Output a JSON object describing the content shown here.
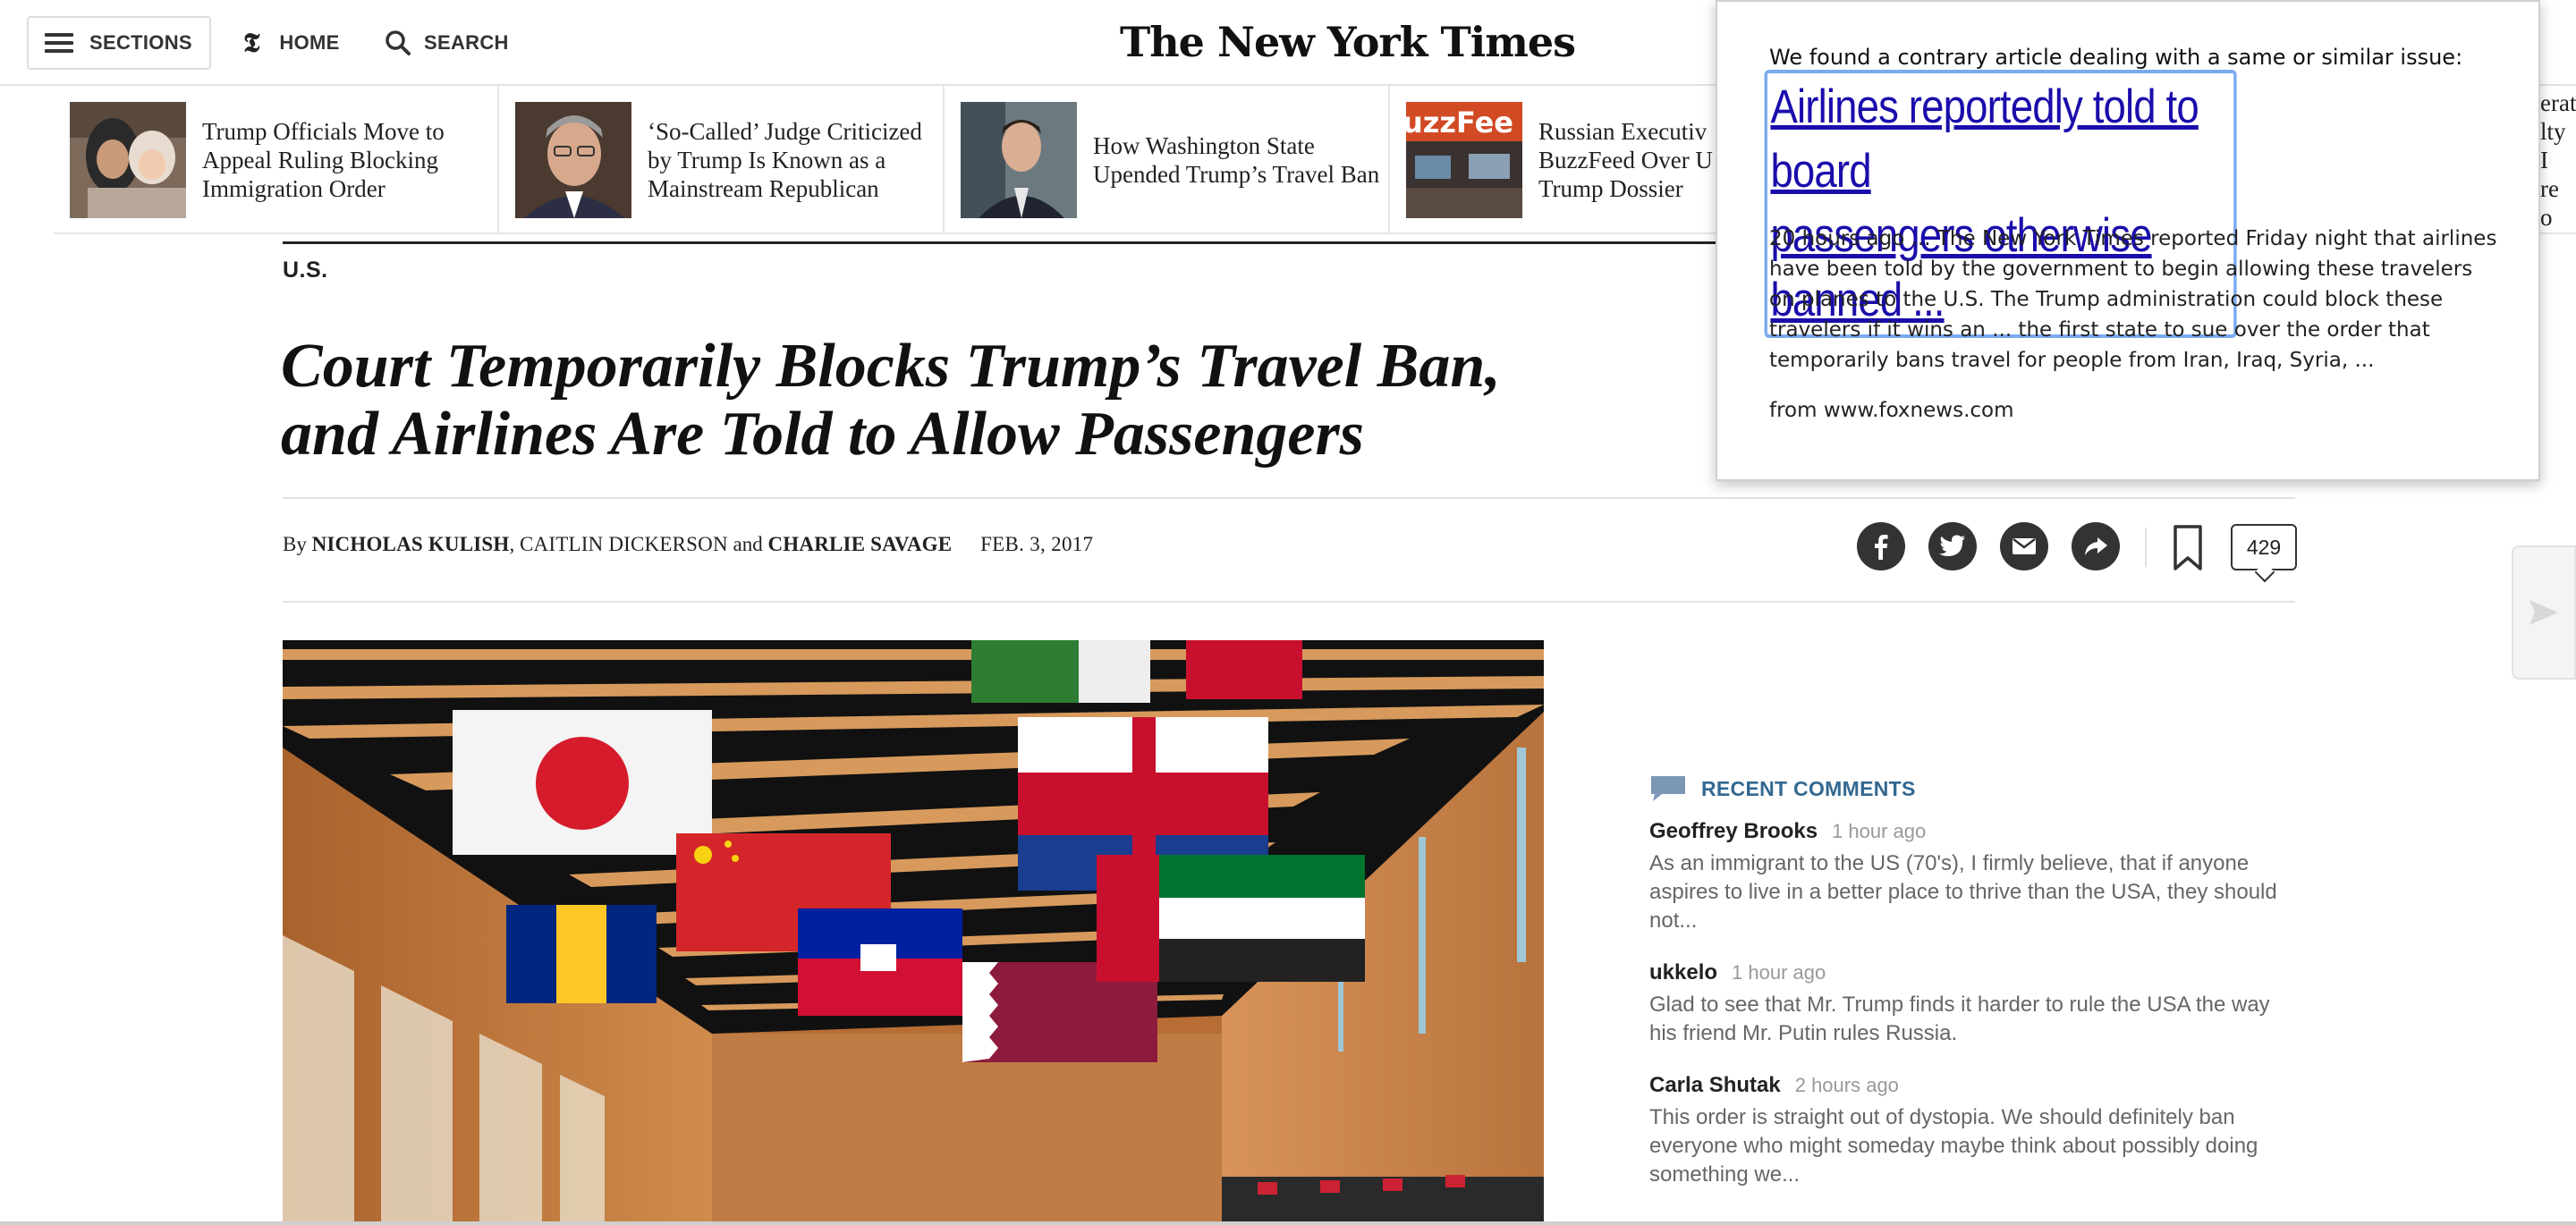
{
  "nav": {
    "sections_label": "SECTIONS",
    "home_label": "HOME",
    "search_label": "SEARCH",
    "masthead": "The New York Times"
  },
  "ribbon": [
    {
      "title": "Trump Officials Move to Appeal Ruling Blocking Immigration Order"
    },
    {
      "title": "‘So-Called’ Judge Criticized by Trump Is Known as a Mainstream Republican"
    },
    {
      "title": "How Washington State Upended Trump’s Travel Ban"
    },
    {
      "title": "Russian Executive Sues BuzzFeed Over Unverified Trump Dossier",
      "visible": "Russian Executiv\nBuzzFeed Over U\nTrump Dossier"
    }
  ],
  "ribbon_right_fragment": "erat\nlty I\nre o",
  "article": {
    "kicker": "U.S.",
    "headline_line1": "Court Temporarily Blocks Trump’s Travel Ban,",
    "headline_line2": "and Airlines Are Told to Allow Passengers",
    "byline_prefix": "By",
    "author1": "NICHOLAS KULISH",
    "sep1": ", ",
    "author2": "CAITLIN DICKERSON",
    "sep2": " and ",
    "author3": "CHARLIE SAVAGE",
    "date": "FEB. 3, 2017",
    "comment_count": "429"
  },
  "comments": {
    "title": "RECENT COMMENTS",
    "items": [
      {
        "name": "Geoffrey Brooks",
        "time": "1 hour ago",
        "text": "As an immigrant to the US (70's), I firmly believe, that if anyone aspires to live in a better place to thrive than the USA, they should not..."
      },
      {
        "name": "ukkelo",
        "time": "1 hour ago",
        "text": "Glad to see that Mr. Trump finds it harder to rule the USA the way his friend Mr. Putin rules Russia."
      },
      {
        "name": "Carla Shutak",
        "time": "2 hours ago",
        "text": "This order is straight out of dystopia. We should definitely ban everyone who might someday maybe think about possibly doing something we..."
      }
    ]
  },
  "popup": {
    "intro": "We found a contrary article dealing with a same or similar issue:",
    "link_line1": "Airlines reportedly told to board",
    "link_line2": "passengers otherwise banned ...",
    "snippet": "20 hours ago ... The New York Times reported Friday night that airlines have been told by the government to begin allowing these travelers on planes to the U.S. The Trump administration could block these travelers if it wins an ... the first state to sue over the order that temporarily bans travel for people from Iran, Iraq, Syria, ...",
    "source": "from www.foxnews.com"
  },
  "colors": {
    "link": "#1a0dab",
    "link_focus": "#7aaaf0",
    "comments_accent": "#326891"
  },
  "icons": [
    "hamburger-icon",
    "nyt-t-icon",
    "search-icon",
    "gear-icon",
    "facebook-icon",
    "twitter-icon",
    "email-icon",
    "share-icon",
    "bookmark-icon",
    "comment-bubble-icon",
    "arrow-right-icon"
  ]
}
